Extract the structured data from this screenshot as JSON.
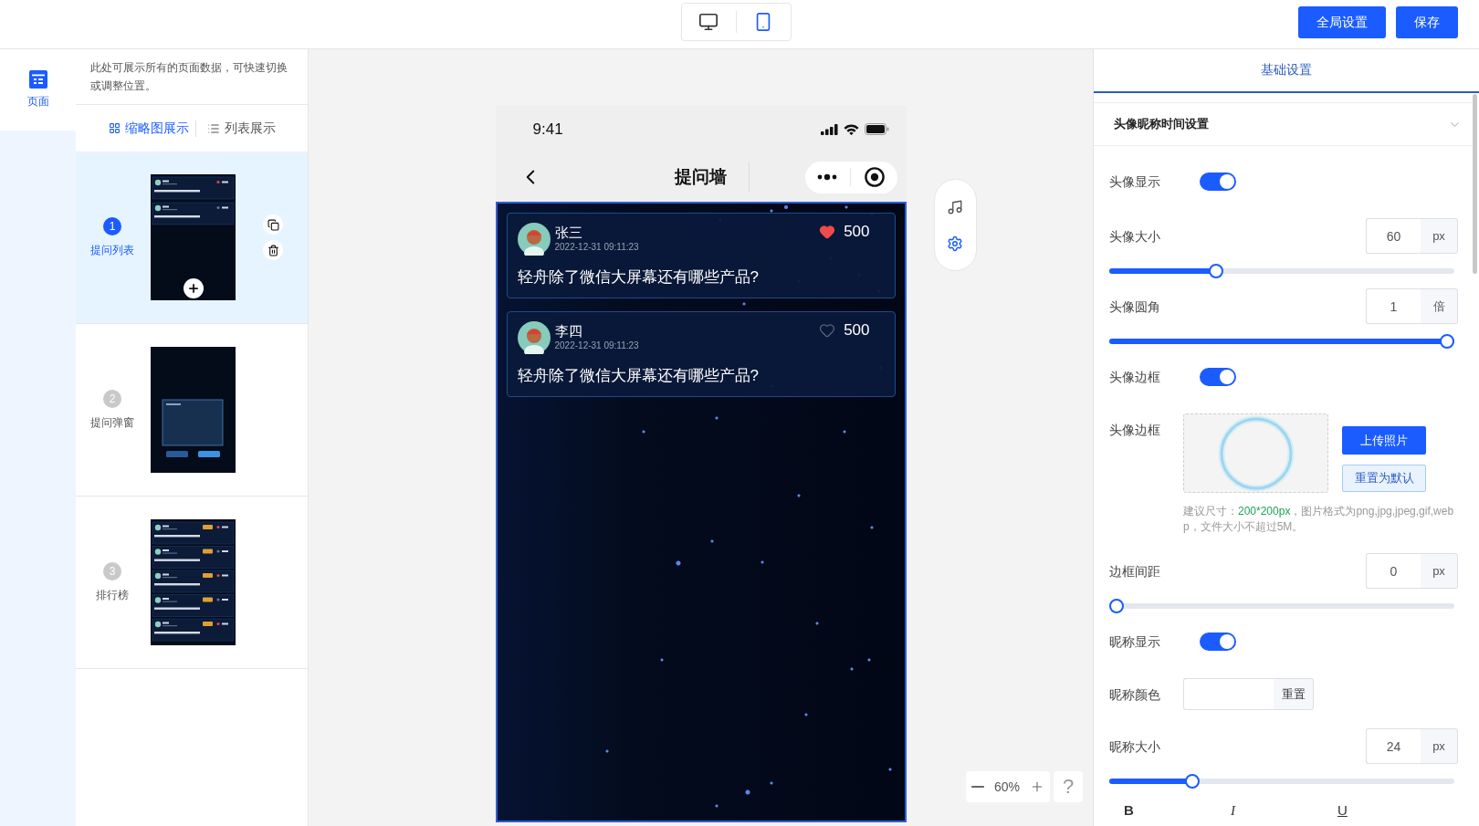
{
  "top_bar": {
    "device_toggle": [
      {
        "kind": "desktop",
        "selected": false
      },
      {
        "kind": "mobile",
        "selected": true
      }
    ],
    "buttons": [
      "全局设置",
      "保存"
    ]
  },
  "rail": [
    {
      "label": "页面",
      "selected": true
    }
  ],
  "pages_panel": {
    "description": "此处可展示所有的页面数据，可快速切换或调整位置。",
    "view_tabs": [
      {
        "kind": "grid",
        "label": "缩略图展示",
        "selected": true
      },
      {
        "kind": "list",
        "label": "列表展示",
        "selected": false
      }
    ],
    "pages": [
      {
        "number": "1",
        "name": "提问列表",
        "kind": "list",
        "selected": true
      },
      {
        "number": "2",
        "name": "提问弹窗",
        "kind": "dialog",
        "selected": false
      },
      {
        "number": "3",
        "name": "排行榜",
        "kind": "ranking",
        "selected": false
      }
    ]
  },
  "phone": {
    "status_time": "9:41",
    "title": "提问墙",
    "posts": [
      {
        "name": "张三",
        "time": "2022-12-31 09:11:23",
        "liked": true,
        "likes": "500",
        "question": "轻舟除了微信大屏幕还有哪些产品?"
      },
      {
        "name": "李四",
        "time": "2022-12-31 09:11:23",
        "liked": false,
        "likes": "500",
        "question": "轻舟除了微信大屏幕还有哪些产品?"
      }
    ]
  },
  "zoom": {
    "level_text": "60%",
    "help": "?"
  },
  "settings": {
    "tabs": [
      {
        "label": "基础设置",
        "selected": true
      }
    ],
    "section": {
      "title": "头像昵称时间设置",
      "expanded": true
    },
    "rows": [
      {
        "kind": "toggle",
        "label": "头像显示",
        "on": true
      },
      {
        "kind": "number",
        "label": "头像大小",
        "value": "60",
        "unit": "px",
        "level": 0.3
      },
      {
        "kind": "number",
        "label": "头像圆角",
        "value": "1",
        "unit": "倍",
        "level": 1
      },
      {
        "kind": "toggle",
        "label": "头像边框",
        "on": true
      },
      {
        "kind": "image",
        "label": "头像边框",
        "upload_button": "上传照片",
        "reset_button": "重置为默认",
        "hint": {
          "lead": "建议尺寸：",
          "size": "200*200px",
          "rest": "，图片格式为png,jpg,jpeg,gif,webp，文件大小不超过5M。"
        }
      },
      {
        "kind": "number",
        "label": "边框间距",
        "value": "0",
        "unit": "px",
        "level": 0
      },
      {
        "kind": "toggle",
        "label": "昵称显示",
        "on": true
      },
      {
        "kind": "color",
        "label": "昵称颜色",
        "reset_button": "重置"
      },
      {
        "kind": "number",
        "label": "昵称大小",
        "value": "24",
        "unit": "px",
        "level": 0.23
      },
      {
        "kind": "format",
        "buttons": [
          {
            "kind": "bold",
            "label": "B"
          },
          {
            "kind": "italic",
            "label": "I"
          },
          {
            "kind": "underline",
            "label": "U"
          }
        ]
      }
    ]
  }
}
